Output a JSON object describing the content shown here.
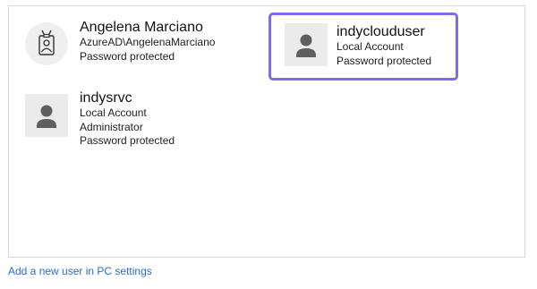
{
  "users": [
    {
      "name": "Angelena Marciano",
      "details": [
        "AzureAD\\AngelenaMarciano",
        "Password protected"
      ],
      "avatar_icon": "id-badge-icon",
      "selected": false
    },
    {
      "name": "indyclouduser",
      "details": [
        "Local Account",
        "Password protected"
      ],
      "avatar_icon": "person-icon",
      "selected": true
    },
    {
      "name": "indysrvc",
      "details": [
        "Local Account",
        "Administrator",
        "Password protected"
      ],
      "avatar_icon": "person-icon",
      "selected": false
    }
  ],
  "add_user_link": "Add a new user in PC settings",
  "colors": {
    "selection_border": "#7b6ee8",
    "link": "#2a6ccf"
  }
}
